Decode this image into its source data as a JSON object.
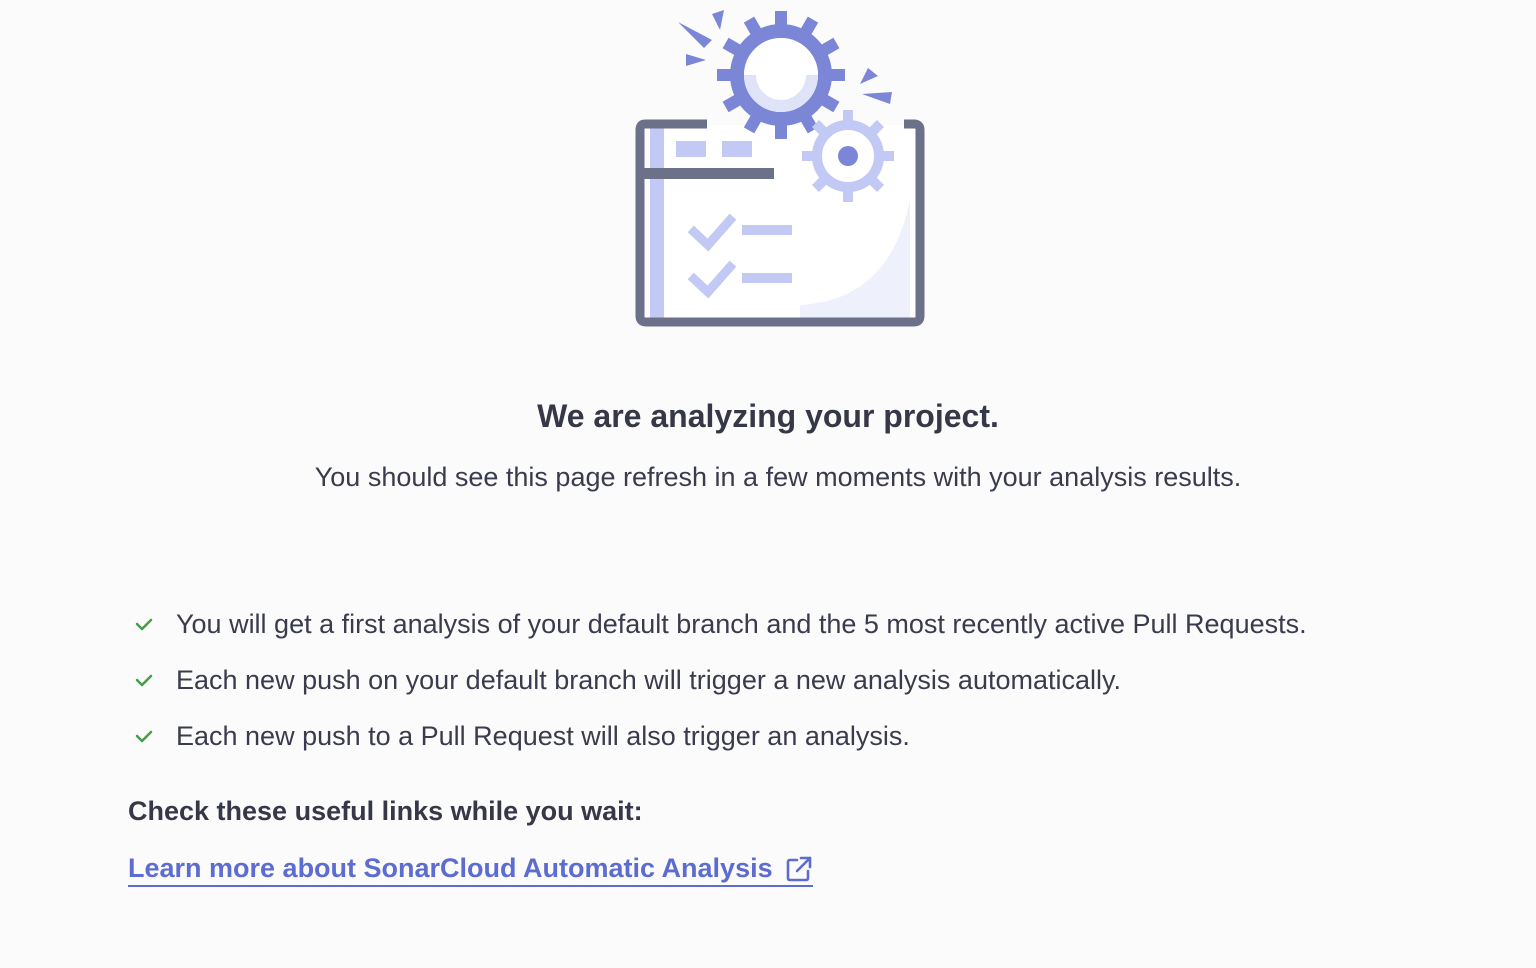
{
  "main": {
    "heading": "We are analyzing your project.",
    "subtitle": "You should see this page refresh in a few moments with your analysis results.",
    "features": [
      "You will get a first analysis of your default branch and the 5 most recently active Pull Requests.",
      "Each new push on your default branch will trigger a new analysis automatically.",
      "Each new push to a Pull Request will also trigger an analysis."
    ],
    "links_heading": "Check these useful links while you wait:",
    "learn_link": "Learn more about SonarCloud Automatic Analysis"
  },
  "icons": {
    "illustration": "analysis-in-progress-illustration",
    "check": "check-icon",
    "external": "external-link-icon"
  },
  "colors": {
    "accent": "#5d6cd0",
    "check": "#43a047",
    "gear": "#7b87d6",
    "gear_light": "#c3c9f5",
    "frame": "#6b7189",
    "text": "#3a3c4d"
  }
}
